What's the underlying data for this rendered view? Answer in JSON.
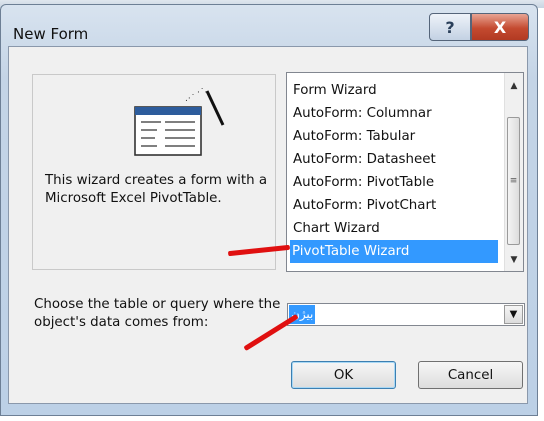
{
  "window": {
    "title": "New Form",
    "help_glyph": "?",
    "close_glyph": "X"
  },
  "preview": {
    "icon": "wizard-wand-table-icon",
    "description": "This wizard creates a form with a Microsoft Excel PivotTable."
  },
  "wizard_list": {
    "items": [
      {
        "label": "Form Wizard",
        "selected": false
      },
      {
        "label": "AutoForm:  Columnar",
        "selected": false
      },
      {
        "label": "AutoForm:  Tabular",
        "selected": false
      },
      {
        "label": "AutoForm:  Datasheet",
        "selected": false
      },
      {
        "label": "AutoForm:  PivotTable",
        "selected": false
      },
      {
        "label": "AutoForm:  PivotChart",
        "selected": false
      },
      {
        "label": "Chart Wizard",
        "selected": false
      },
      {
        "label": "PivotTable Wizard",
        "selected": true
      }
    ],
    "scroll_up_glyph": "▲",
    "scroll_down_glyph": "▼",
    "thumb_grip_glyph": "≡"
  },
  "source": {
    "prompt": "Choose the table or query where the object's data comes from:",
    "selected_value": "بیژن",
    "dropdown_glyph": "▼"
  },
  "buttons": {
    "ok": "OK",
    "cancel": "Cancel"
  },
  "annotation_color": "#e01010",
  "selection_color": "#3399ff"
}
